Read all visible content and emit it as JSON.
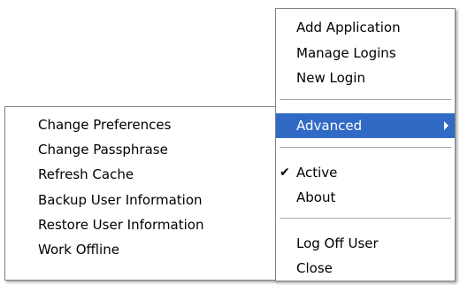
{
  "main_menu": {
    "items": [
      {
        "label": "Add Application"
      },
      {
        "label": "Manage Logins"
      },
      {
        "label": "New Login"
      },
      {
        "label": "Advanced",
        "has_submenu": true,
        "highlighted": true
      },
      {
        "label": "Active",
        "checked": true
      },
      {
        "label": "About"
      },
      {
        "label": "Log Off User"
      },
      {
        "label": "Close"
      }
    ],
    "check_glyph": "✔"
  },
  "sub_menu": {
    "items": [
      {
        "label": "Change Preferences"
      },
      {
        "label": "Change Passphrase"
      },
      {
        "label": "Refresh Cache"
      },
      {
        "label": "Backup User Information"
      },
      {
        "label": "Restore User Information"
      },
      {
        "label": "Work Offline"
      }
    ]
  },
  "colors": {
    "highlight_bg": "#316ac5",
    "highlight_text": "#ffffff",
    "separator": "#aca899"
  }
}
